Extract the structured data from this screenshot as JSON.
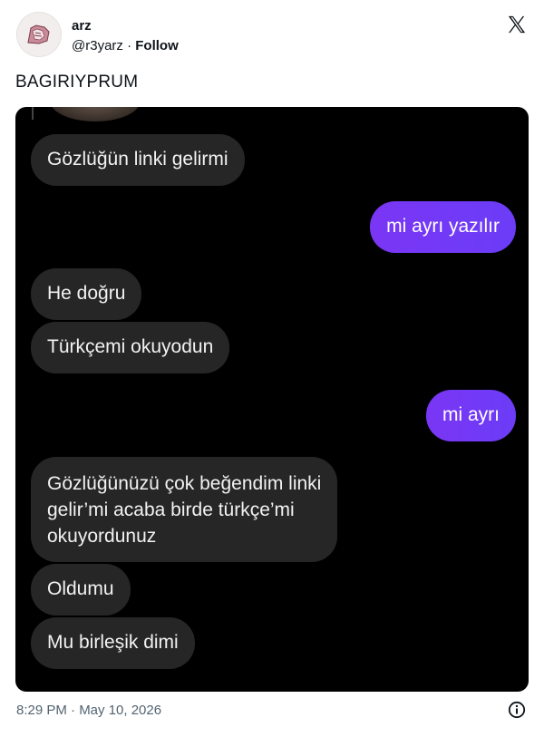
{
  "author": {
    "name": "arz",
    "handle": "@r3yarz",
    "separator": "·",
    "follow_label": "Follow"
  },
  "tweet_text": "BAGIRIYPRUM",
  "chat": [
    {
      "side": "received",
      "text": "Gözlüğün linki gelirmi"
    },
    {
      "side": "sent",
      "text": "mi ayrı yazılır"
    },
    {
      "side": "received",
      "text": "He doğru"
    },
    {
      "side": "received",
      "text": "Türkçemi okuyodun"
    },
    {
      "side": "sent",
      "text": "mi ayrı"
    },
    {
      "side": "received",
      "text": "Gözlüğünüzü çok beğendim linki\ngelir’mi acaba birde türkçe’mi\nokuyordunuz"
    },
    {
      "side": "received",
      "text": "Oldumu"
    },
    {
      "side": "received",
      "text": "Mu birleşik dimi"
    }
  ],
  "timestamp": "8:29 PM · May 10, 2026",
  "icons": {
    "logo": "x-logo-icon",
    "info": "info-icon"
  },
  "colors": {
    "sent_bubble": "#7a36f5",
    "received_bubble": "#262626",
    "chat_background": "#000000"
  }
}
